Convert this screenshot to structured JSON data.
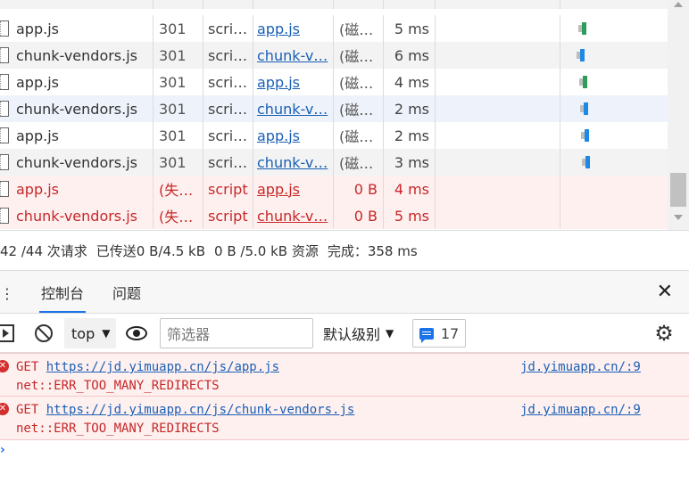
{
  "network": {
    "rows": [
      {
        "name": "app.js",
        "status": "301",
        "type": "scri…",
        "initiator": "app.js",
        "size": "(磁…",
        "time": "5 ms",
        "error": false,
        "bar": "green"
      },
      {
        "name": "chunk-vendors.js",
        "status": "301",
        "type": "scri…",
        "initiator": "chunk-v…",
        "size": "(磁…",
        "time": "6 ms",
        "error": false,
        "bar": "blue"
      },
      {
        "name": "app.js",
        "status": "301",
        "type": "scri…",
        "initiator": "app.js",
        "size": "(磁…",
        "time": "4 ms",
        "error": false,
        "bar": "green"
      },
      {
        "name": "chunk-vendors.js",
        "status": "301",
        "type": "scri…",
        "initiator": "chunk-v…",
        "size": "(磁…",
        "time": "2 ms",
        "error": false,
        "bar": "blue"
      },
      {
        "name": "app.js",
        "status": "301",
        "type": "scri…",
        "initiator": "app.js",
        "size": "(磁…",
        "time": "2 ms",
        "error": false,
        "bar": "blue"
      },
      {
        "name": "chunk-vendors.js",
        "status": "301",
        "type": "scri…",
        "initiator": "chunk-v…",
        "size": "(磁…",
        "time": "3 ms",
        "error": false,
        "bar": "blue"
      },
      {
        "name": "app.js",
        "status": "(失…",
        "type": "script",
        "initiator": "app.js",
        "size": "0 B",
        "time": "4 ms",
        "error": true,
        "bar": "none"
      },
      {
        "name": "chunk-vendors.js",
        "status": "(失…",
        "type": "script",
        "initiator": "chunk-v…",
        "size": "0 B",
        "time": "5 ms",
        "error": true,
        "bar": "none"
      }
    ]
  },
  "summary": {
    "requests": "42 /44 次请求",
    "transferred": "已传送0 B/4.5 kB",
    "resources": "0 B /5.0 kB 资源",
    "finish": "完成：358 ms"
  },
  "drawer": {
    "menu_label": "⋮",
    "tab_console": "控制台",
    "tab_issues": "问题",
    "close_label": "✕"
  },
  "toolbar": {
    "context": "top",
    "filter_placeholder": "筛选器",
    "level": "默认级别",
    "issues_count": "17",
    "settings_glyph": "⚙"
  },
  "messages": [
    {
      "method": "GET",
      "url": "https://jd.yimuapp.cn/js/app.js",
      "error": "net::ERR_TOO_MANY_REDIRECTS",
      "source": "jd.yimuapp.cn/:9"
    },
    {
      "method": "GET",
      "url": "https://jd.yimuapp.cn/js/chunk-vendors.js",
      "error": "net::ERR_TOO_MANY_REDIRECTS",
      "source": "jd.yimuapp.cn/:9"
    }
  ],
  "colors": {
    "error_text": "#c62828",
    "error_bg": "#fff0f0",
    "link": "#1a5fb4",
    "accent": "#1a73e8",
    "bar_blue": "#1e88e5",
    "bar_green": "#2e9d5b"
  }
}
